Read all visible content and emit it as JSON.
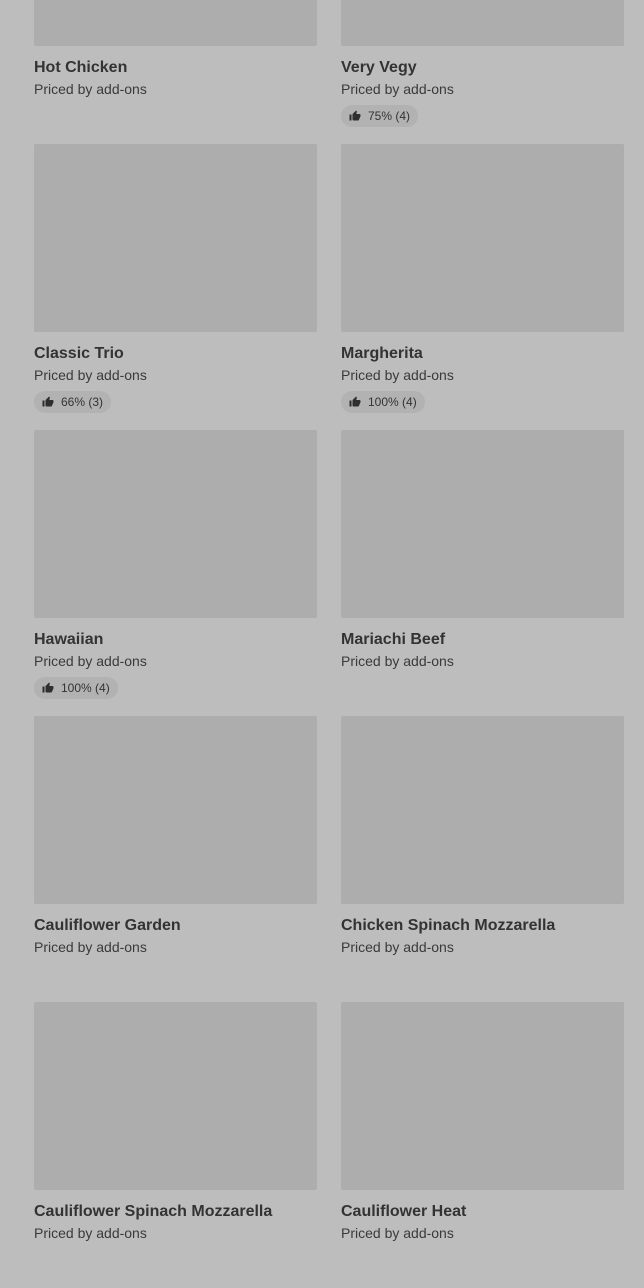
{
  "menu": {
    "items": [
      {
        "name": "Hot Chicken",
        "price": "Priced by add-ons",
        "rating": null
      },
      {
        "name": "Very Vegy",
        "price": "Priced by add-ons",
        "rating": "75% (4)"
      },
      {
        "name": "Classic Trio",
        "price": "Priced by add-ons",
        "rating": "66% (3)"
      },
      {
        "name": "Margherita",
        "price": "Priced by add-ons",
        "rating": "100% (4)"
      },
      {
        "name": "Hawaiian",
        "price": "Priced by add-ons",
        "rating": "100% (4)"
      },
      {
        "name": "Mariachi Beef",
        "price": "Priced by add-ons",
        "rating": null
      },
      {
        "name": "Cauliflower Garden",
        "price": "Priced by add-ons",
        "rating": null
      },
      {
        "name": "Chicken Spinach Mozzarella",
        "price": "Priced by add-ons",
        "rating": null
      },
      {
        "name": "Cauliflower Spinach Mozzarella",
        "price": "Priced by add-ons",
        "rating": null
      },
      {
        "name": "Cauliflower Heat",
        "price": "Priced by add-ons",
        "rating": null
      }
    ]
  },
  "icons": {
    "rating_icon": "thumbs-up-icon"
  },
  "colors": {
    "background": "#bdbdbd",
    "image_placeholder": "#adadad",
    "rating_pill": "#b2b2b2"
  }
}
